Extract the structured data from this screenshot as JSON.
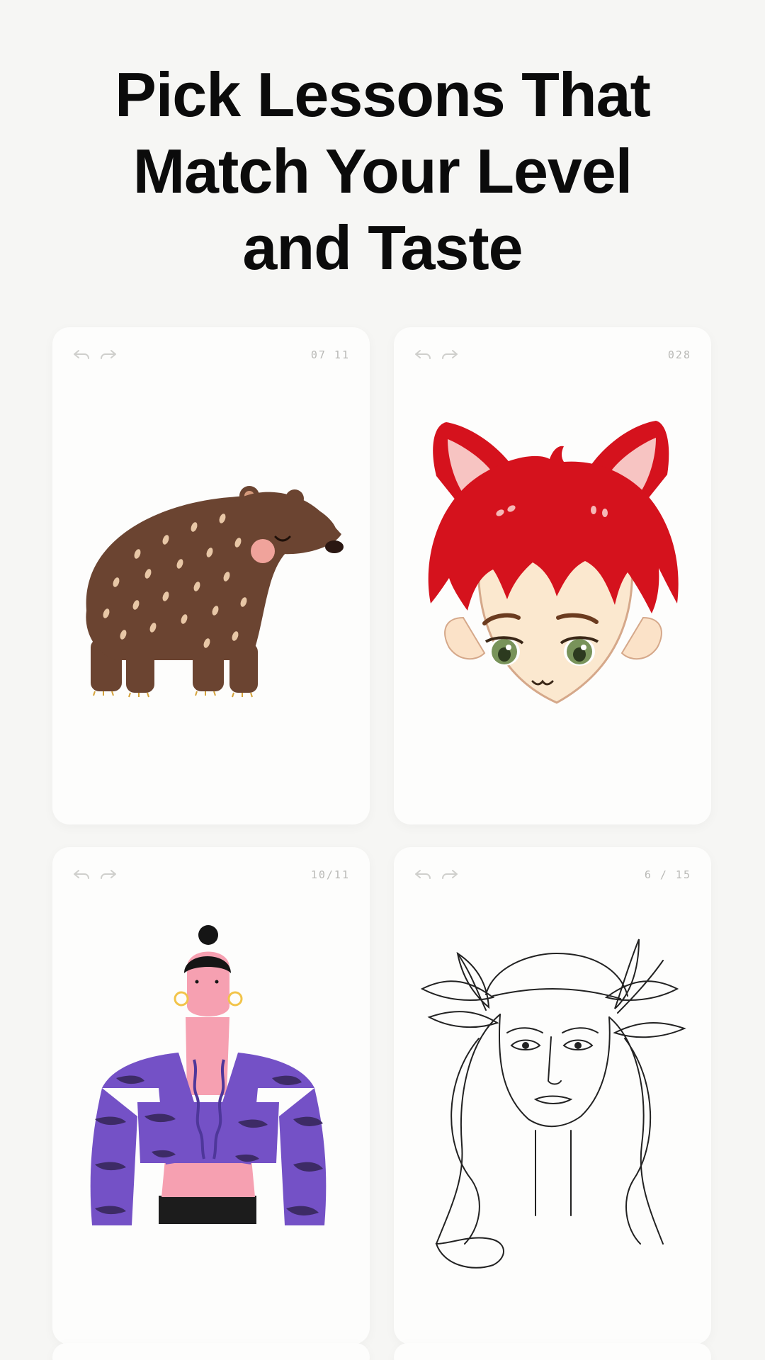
{
  "headline": {
    "line1": "Pick Lessons That",
    "line2": "Match Your Level",
    "line3": "and Taste"
  },
  "cards": [
    {
      "counter": "07 11",
      "subject": "bear",
      "icons": [
        "undo-icon",
        "redo-icon"
      ]
    },
    {
      "counter": "028",
      "subject": "fox-eared-boy",
      "icons": [
        "undo-icon",
        "redo-icon"
      ]
    },
    {
      "counter": "10/11",
      "subject": "woman-purple-top",
      "icons": [
        "undo-icon",
        "redo-icon"
      ]
    },
    {
      "counter": "6 / 15",
      "subject": "line-art-face",
      "icons": [
        "undo-icon",
        "redo-icon"
      ]
    }
  ],
  "colors": {
    "background": "#f6f6f4",
    "card": "#fdfdfc",
    "bear": "#6b4431",
    "hair": "#d5121d",
    "shirt": "#7451c6"
  }
}
